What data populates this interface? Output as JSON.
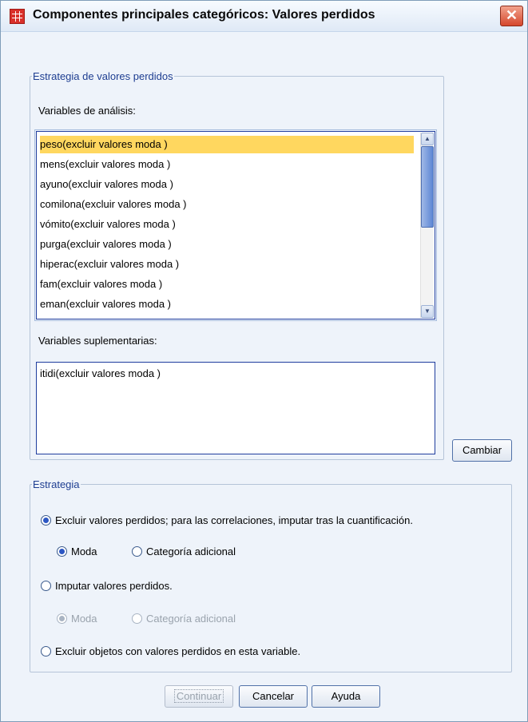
{
  "window": {
    "title": "Componentes principales categóricos: Valores perdidos",
    "close_glyph": "✕"
  },
  "strategy_group": {
    "legend": "Estrategia de valores perdidos",
    "analysis_label": "Variables de análisis:",
    "analysis_items": [
      "peso(excluir valores moda )",
      "mens(excluir valores moda )",
      "ayuno(excluir valores moda )",
      "comilona(excluir valores moda )",
      "vómito(excluir valores moda )",
      "purga(excluir valores moda )",
      "hiperac(excluir valores moda )",
      "fam(excluir valores moda )",
      "eman(excluir valores moda )"
    ],
    "supplementary_label": "Variables suplementarias:",
    "supplementary_items": [
      "itidi(excluir valores moda )"
    ]
  },
  "change_button": "Cambiar",
  "strategy": {
    "legend": "Estrategia",
    "opt_exclude": "Excluir valores perdidos; para las correlaciones, imputar tras la cuantificación.",
    "opt_exclude_mode": "Moda",
    "opt_exclude_extra": "Categoría adicional",
    "opt_impute": "Imputar valores perdidos.",
    "opt_impute_mode": "Moda",
    "opt_impute_extra": "Categoría adicional",
    "opt_exclude_objects": "Excluir objetos con valores perdidos en esta variable."
  },
  "footer": {
    "continue": "Continuar",
    "cancel": "Cancelar",
    "help": "Ayuda"
  },
  "icons": {
    "app": "grid-app-icon",
    "close": "close-icon",
    "scroll_up": "arrow-up-icon",
    "scroll_down": "arrow-down-icon"
  },
  "colors": {
    "accent": "#2c57c4",
    "selection": "#ffd75f",
    "group_legend": "#1e3e91"
  }
}
